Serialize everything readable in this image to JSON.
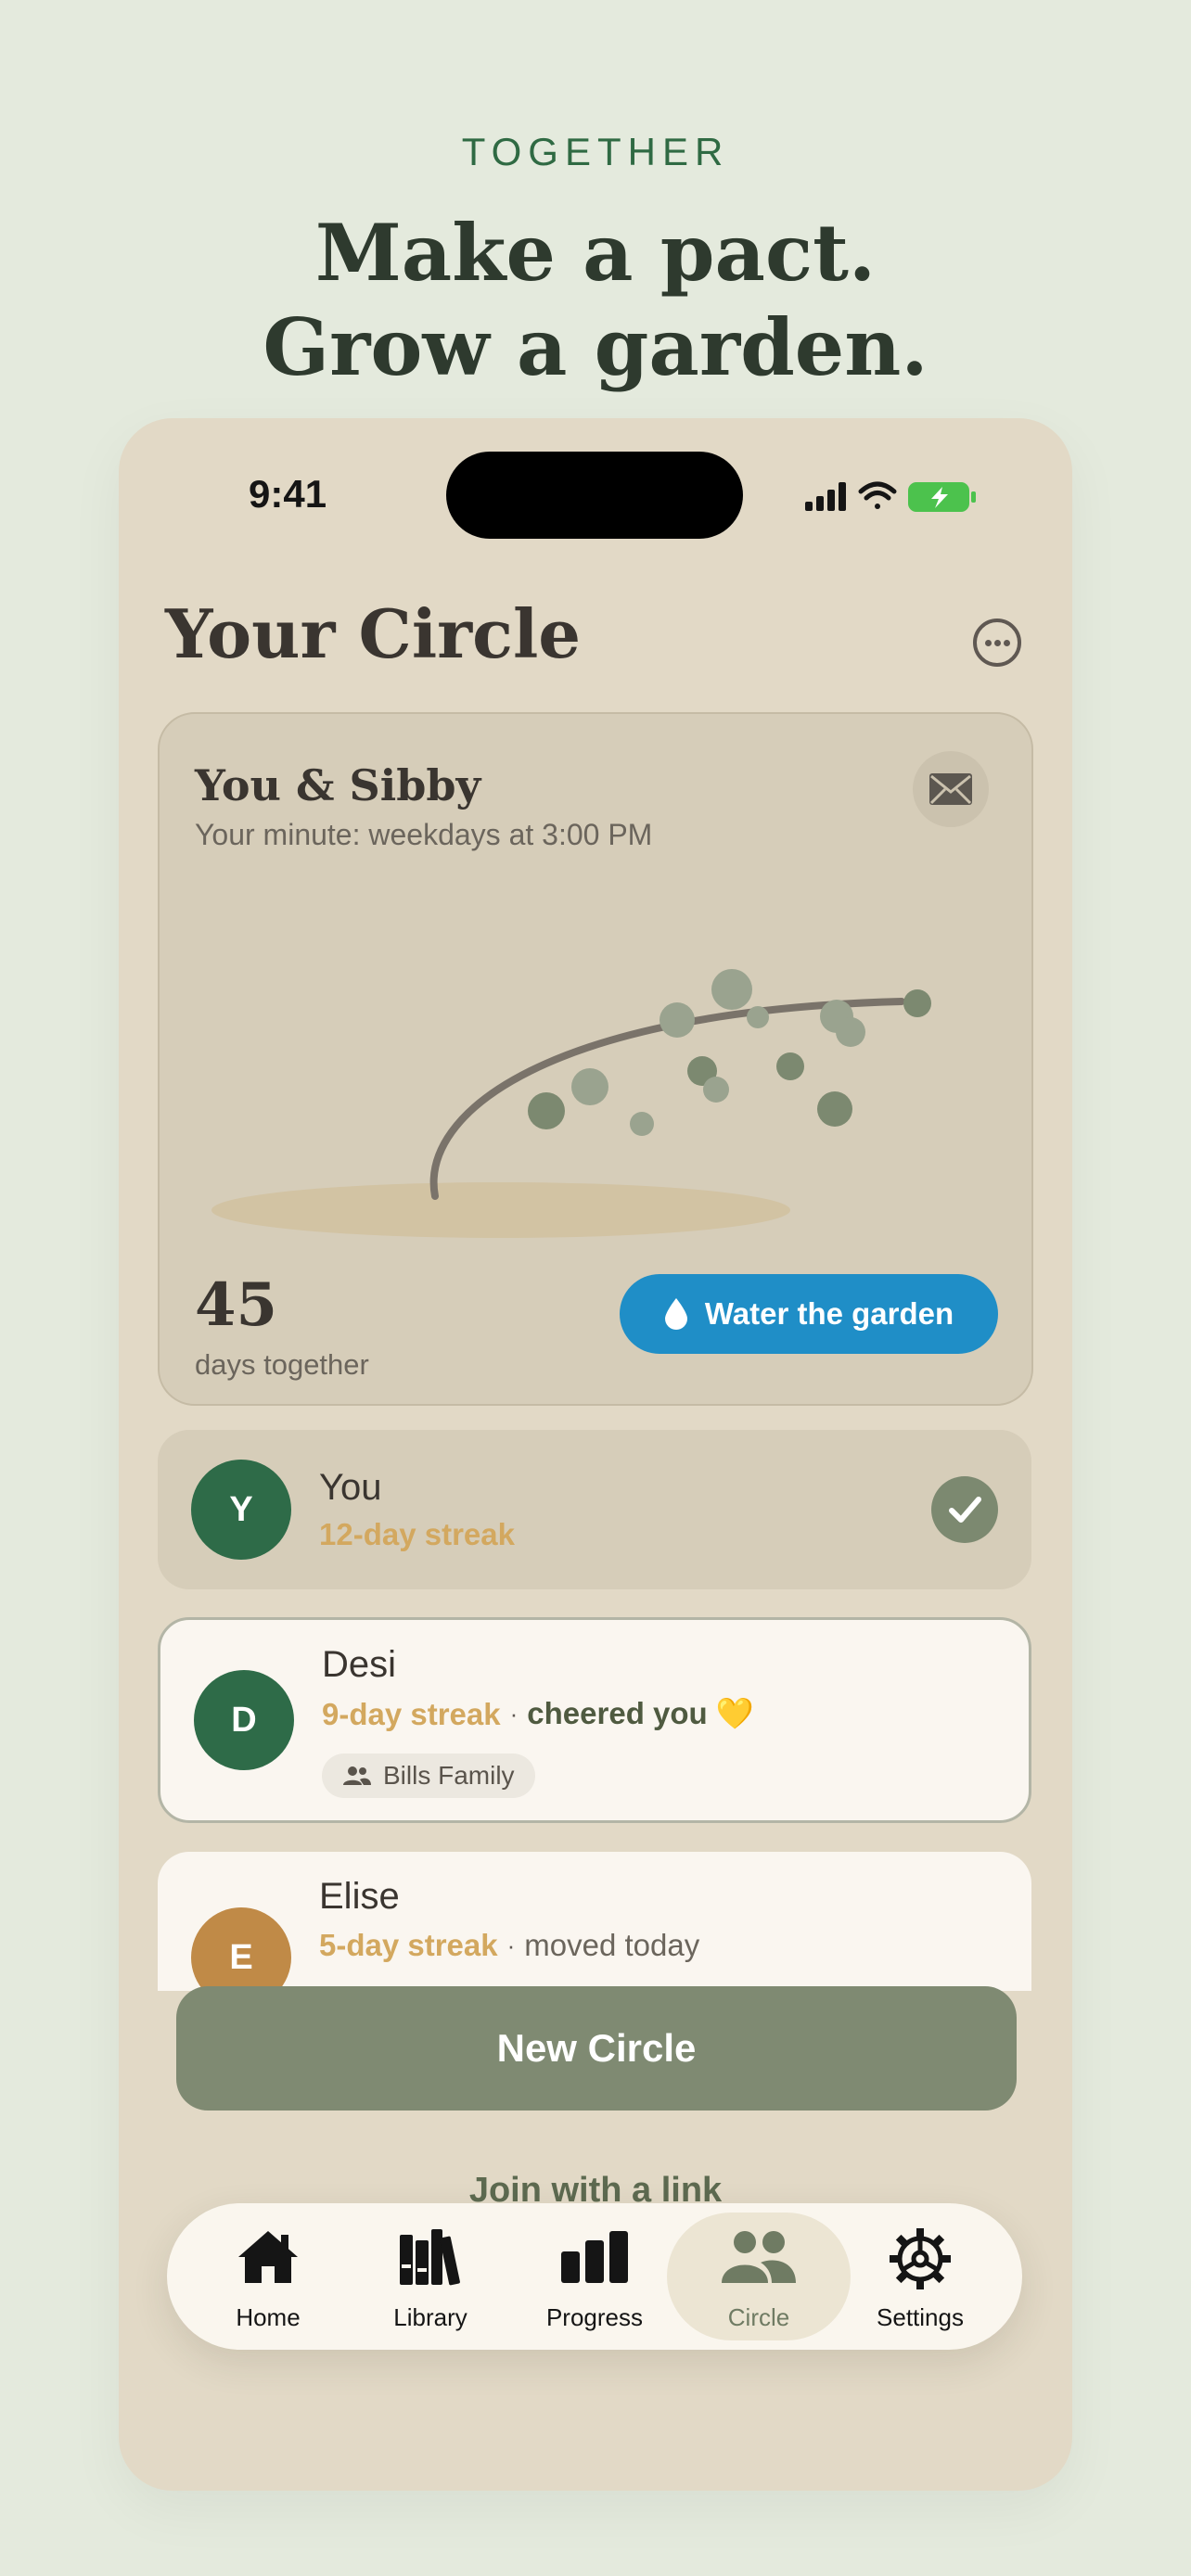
{
  "header": {
    "eyebrow": "TOGETHER",
    "headline_line1": "Make a pact.",
    "headline_line2": "Grow a garden."
  },
  "status_bar": {
    "time": "9:41"
  },
  "page": {
    "title": "Your Circle"
  },
  "garden_card": {
    "name": "You & Sibby",
    "subtitle": "Your minute: weekdays at 3:00 PM",
    "days_count": "45",
    "days_label": "days together",
    "water_button": "Water the garden"
  },
  "members": {
    "you": {
      "initial": "Y",
      "name": "You",
      "streak": "12-day streak",
      "checked": true
    },
    "desi": {
      "initial": "D",
      "name": "Desi",
      "streak": "9-day streak",
      "separator": "·",
      "activity": "cheered you 💛",
      "group_tag": "Bills Family"
    },
    "elise": {
      "initial": "E",
      "name": "Elise",
      "streak": "5-day streak",
      "separator": "·",
      "activity": "moved today"
    }
  },
  "actions": {
    "new_circle": "New Circle",
    "join_link": "Join with a link"
  },
  "tabs": [
    {
      "label": "Home",
      "icon": "house-icon"
    },
    {
      "label": "Library",
      "icon": "books-icon"
    },
    {
      "label": "Progress",
      "icon": "bar-chart-icon"
    },
    {
      "label": "Circle",
      "icon": "people-icon",
      "active": true
    },
    {
      "label": "Settings",
      "icon": "gear-icon"
    }
  ],
  "colors": {
    "background": "#e4eadd",
    "phone": "#e2d9c6",
    "accent_green": "#2e6b48",
    "water_blue": "#1f8ec7",
    "streak_gold": "#d3a85f",
    "sage_button": "#7f8a72"
  }
}
